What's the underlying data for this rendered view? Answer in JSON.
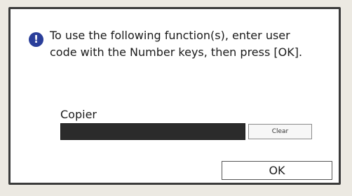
{
  "dialog": {
    "message_lines": [
      "To use the following function(s), enter user",
      "code with the Number keys, then press [OK]."
    ],
    "field_label": "Copier",
    "code_value": "",
    "clear_label": "Clear",
    "ok_label": "OK",
    "icon": "info-icon",
    "icon_glyph": "!",
    "colors": {
      "icon_background": "#2a3e9a",
      "code_field_background": "#2b2b2b",
      "dialog_border": "#3a3a3a"
    }
  }
}
